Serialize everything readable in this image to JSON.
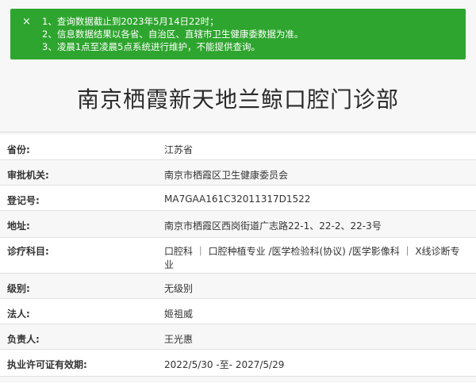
{
  "notice": {
    "close_icon": "×",
    "lines": [
      "1、查询数据截止到2023年5月14日22时；",
      "2、信息数据结果以各省、自治区、直辖市卫生健康委数据为准。",
      "3、凌晨1点至凌晨5点系统进行维护，不能提供查询。"
    ]
  },
  "title": "南京栖霞新天地兰鲸口腔门诊部",
  "rows": [
    {
      "label": "省份:",
      "value": "江苏省"
    },
    {
      "label": "审批机关:",
      "value": "南京市栖霞区卫生健康委员会"
    },
    {
      "label": "登记号:",
      "value": "MA7GAA161C32011317D1522"
    },
    {
      "label": "地址:",
      "value": "南京市栖霞区西岗街道广志路22-1、22-2、22-3号"
    },
    {
      "label": "诊疗科目:",
      "value": "口腔科 ｜ 口腔种植专业 /医学检验科(协议) /医学影像科 ｜ X线诊断专业",
      "extra": "******"
    },
    {
      "label": "级别:",
      "value": "无级别"
    },
    {
      "label": "法人:",
      "value": "姬祖威"
    },
    {
      "label": "负责人:",
      "value": "王光惠"
    },
    {
      "label": "执业许可证有效期:",
      "value": "2022/5/30 -至- 2027/5/29"
    }
  ]
}
